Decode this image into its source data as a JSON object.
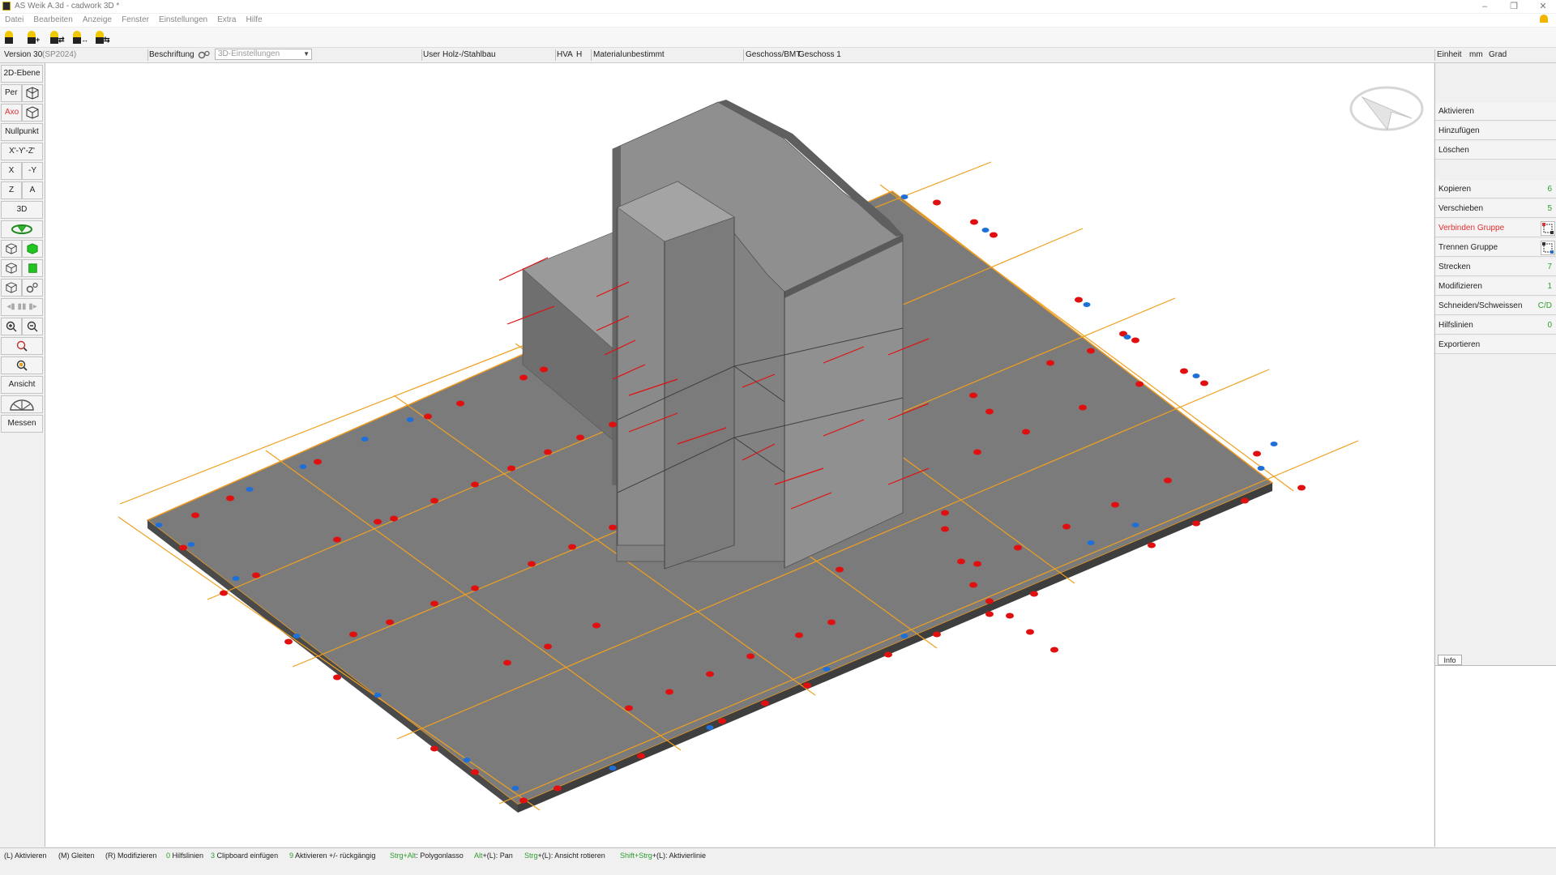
{
  "window": {
    "title": "AS Weik A.3d - cadwork 3D *",
    "minimize": "–",
    "restore": "❐",
    "close": "✕"
  },
  "menu": [
    "Datei",
    "Bearbeiten",
    "Anzeige",
    "Fenster",
    "Einstellungen",
    "Extra",
    "Hilfe"
  ],
  "toolbar": {
    "icons": [
      "user-plus-icon",
      "user-add-icon",
      "user-copy-icon",
      "user-move-icon",
      "user-swap-icon"
    ],
    "suffixes": [
      "",
      "+",
      "⇄",
      "↔",
      "⇆"
    ]
  },
  "infobar": {
    "version_label": "Version 30",
    "version_sub": "(SP2024)",
    "beschriftung": "Beschriftung",
    "einstellungen_value": "3D-Einstellungen",
    "user_label": "User",
    "user_value": "Holz-/Stahlbau",
    "hva": "HVA",
    "h": "H",
    "material_label": "Material",
    "material_value": "unbestimmt",
    "geschoss_label": "Geschoss/BMT",
    "geschoss_value": "Geschoss 1",
    "einheit_label": "Einheit",
    "einheit_mm": "mm",
    "einheit_grad": "Grad"
  },
  "left_panel": {
    "ebene": "2D-Ebene",
    "per": "Per",
    "axo": "Axo",
    "nullpunkt": "Nullpunkt",
    "xyz": "X'-Y'-Z'",
    "x": "X",
    "minus_y": "-Y",
    "z": "Z",
    "a": "A",
    "three_d": "3D",
    "ansicht": "Ansicht",
    "messen": "Messen"
  },
  "right_panel": {
    "items": [
      {
        "label": "Aktivieren",
        "count": ""
      },
      {
        "label": "Hinzufügen",
        "count": ""
      },
      {
        "label": "Löschen",
        "count": ""
      },
      {
        "label": "Kopieren",
        "count": "6"
      },
      {
        "label": "Verschieben",
        "count": "5"
      },
      {
        "label": "Verbinden Gruppe",
        "count": ""
      },
      {
        "label": "Trennen Gruppe",
        "count": ""
      },
      {
        "label": "Strecken",
        "count": "7"
      },
      {
        "label": "Modifizieren",
        "count": "1"
      },
      {
        "label": "Schneiden/Schweissen",
        "count": "C/D"
      },
      {
        "label": "Hilfslinien",
        "count": "0"
      },
      {
        "label": "Exportieren",
        "count": ""
      }
    ],
    "info_tab": "Info"
  },
  "statusbar": [
    {
      "key": "(L)",
      "text": " Aktivieren"
    },
    {
      "key": "(M)",
      "text": " Gleiten"
    },
    {
      "key": "(R)",
      "text": " Modifizieren"
    },
    {
      "key": "0",
      "text": " Hilfslinien"
    },
    {
      "key": "3",
      "text": " Clipboard einfügen"
    },
    {
      "key": "9",
      "text": " Aktivieren +/- rückgängig"
    },
    {
      "key": "Strg+Alt",
      "text": ": Polygonlasso"
    },
    {
      "key": "Alt",
      "text": "+(L): Pan"
    },
    {
      "key": "Strg",
      "text": "+(L): Ansicht rotieren"
    },
    {
      "key": "Shift+Strg",
      "text": "+(L): Aktivierlinie"
    }
  ],
  "colors": {
    "active_red": "#e03030",
    "count_green": "#2ea02e",
    "slab": "#7b7b7b",
    "wall": "#8d8d8d",
    "axis": "#f0a020",
    "connector_red": "#e01010",
    "connector_blue": "#1f6fd8"
  }
}
